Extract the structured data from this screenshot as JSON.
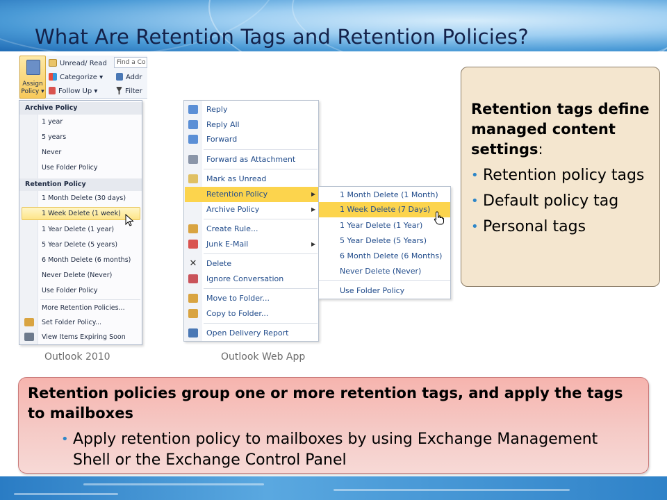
{
  "slide": {
    "title": "What Are Retention Tags and Retention Policies?"
  },
  "outlook2010": {
    "caption": "Outlook 2010",
    "ribbon": {
      "assign_label_line1": "Assign",
      "assign_label_line2": "Policy",
      "unread_read": "Unread/ Read",
      "categorize": "Categorize",
      "follow_up": "Follow Up",
      "find_placeholder": "Find a Co",
      "address": "Addr",
      "filter": "Filter"
    },
    "menu": {
      "archive_header": "Archive Policy",
      "archive_items": [
        "1 year",
        "5 years",
        "Never",
        "Use Folder Policy"
      ],
      "retention_header": "Retention Policy",
      "retention_items": [
        "1 Month Delete (30 days)",
        "1 Week Delete (1 week)",
        "1 Year Delete (1 year)",
        "5 Year Delete (5 years)",
        "6 Month Delete (6 months)",
        "Never Delete (Never)",
        "Use Folder Policy"
      ],
      "footer_items": [
        "More Retention Policies...",
        "Set Folder Policy...",
        "View Items Expiring Soon"
      ]
    }
  },
  "owa": {
    "caption": "Outlook Web App",
    "menu_items": [
      "Reply",
      "Reply All",
      "Forward",
      "Forward as Attachment",
      "Mark as Unread",
      "Retention Policy",
      "Archive Policy",
      "Create Rule...",
      "Junk E-Mail",
      "Delete",
      "Ignore Conversation",
      "Move to Folder...",
      "Copy to Folder...",
      "Open Delivery Report"
    ],
    "submenu_items": [
      "1 Month Delete (1 Month)",
      "1 Week Delete (7 Days)",
      "1 Year Delete (1 Year)",
      "5 Year Delete (5 Years)",
      "6 Month Delete (6 Months)",
      "Never Delete (Never)",
      "Use Folder Policy"
    ]
  },
  "tags_callout": {
    "heading": "Retention tags define managed content settings",
    "colon": ":",
    "bullets": [
      "Retention policy tags",
      "Default policy tag",
      "Personal tags"
    ]
  },
  "policies_callout": {
    "lead": "Retention policies group one or more retention tags, and apply the tags to mailboxes",
    "bullet": "Apply retention policy to mailboxes by using Exchange Management Shell or the Exchange Control Panel"
  },
  "colors": {
    "highlight_yellow": "#fcd44d",
    "bullet_blue": "#2e86c8",
    "callout_tan": "#f4e6cf",
    "callout_pink": "#f5cac6"
  }
}
